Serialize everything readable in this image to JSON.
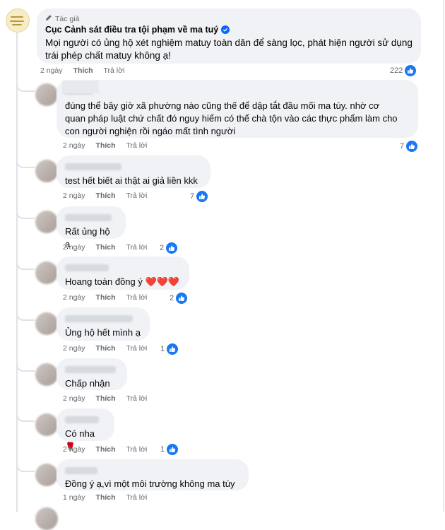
{
  "post": {
    "author_label": "Tác giả",
    "author_name": "Cục Cảnh sát điều tra tội phạm về ma tuý",
    "text_line1": "Mọi người có ủng hộ xét nghiệm matuy toàn dân để sàng lọc, phát hiện người sử dụng",
    "text_line2": "trái phép chất matuy không ạ!",
    "time": "2 ngày",
    "like_label": "Thích",
    "reply_label": "Trả lời",
    "reactions": "222"
  },
  "comments": [
    {
      "lines": [
        "đúng thể bây giờ xã phường nào cũng thế để dập tắt đầu mối ma túy. nhờ cơ",
        "quan pháp luật chứ chất đó nguy hiểm có thể chà tộn vào các thực phẩm làm cho",
        "con người nghiện rồi ngáo mất tình người"
      ],
      "time": "2 ngày",
      "like_label": "Thích",
      "reply_label": "Trả lời",
      "reactions": "7"
    },
    {
      "lines": [
        "test hết biết ai thật ai giả liền kkk"
      ],
      "time": "2 ngày",
      "like_label": "Thích",
      "reply_label": "Trả lời",
      "reactions": "7"
    },
    {
      "lines": [
        "Rất ủng hộ ạ"
      ],
      "time": "2 ngày",
      "like_label": "Thích",
      "reply_label": "Trả lời",
      "reactions": "2"
    },
    {
      "lines": [
        "Hoang toàn đồng ý"
      ],
      "suffix": "❤️❤️❤️",
      "time": "2 ngày",
      "like_label": "Thích",
      "reply_label": "Trả lời",
      "reactions": "2"
    },
    {
      "lines": [
        "Ủng hộ hết mình ạ"
      ],
      "time": "2 ngày",
      "like_label": "Thích",
      "reply_label": "Trả lời",
      "reactions": "1"
    },
    {
      "lines": [
        "Chấp nhận"
      ],
      "time": "2 ngày",
      "like_label": "Thích",
      "reply_label": "Trả lời",
      "reactions": ""
    },
    {
      "lines": [
        "Có nha"
      ],
      "suffix": "🌹",
      "time": "2 ngày",
      "like_label": "Thích",
      "reply_label": "Trả lời",
      "reactions": "1"
    },
    {
      "lines": [
        "Đồng ý ạ,vì một môi trường không ma túy"
      ],
      "time": "1 ngày",
      "like_label": "Thích",
      "reply_label": "Trả lời",
      "reactions": ""
    }
  ],
  "colors": {
    "like_blue": "#1877f2",
    "verified_blue": "#0866ff",
    "bubble_bg": "#f0f2f5",
    "meta_gray": "#65676b"
  },
  "icons": {
    "author_tag": "pencil-icon",
    "verified": "verified-badge-icon",
    "reaction": "thumbs-up-icon"
  }
}
